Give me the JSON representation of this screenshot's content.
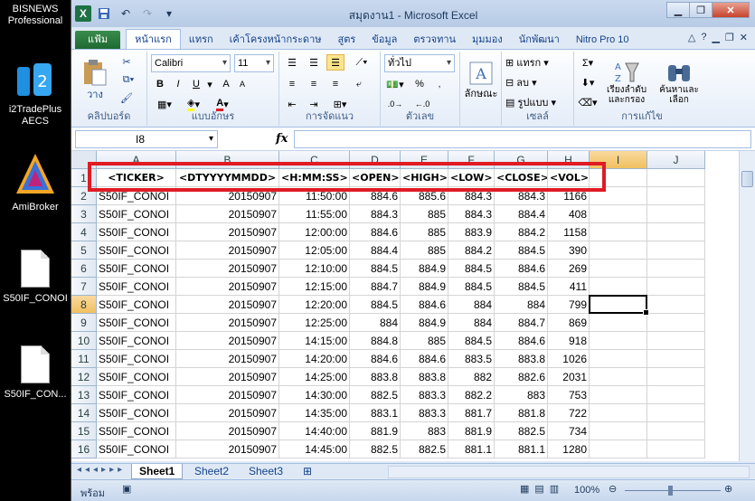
{
  "desktop": {
    "icons": [
      {
        "label": "BISNEWS Professional",
        "icon": "bisnews-icon"
      },
      {
        "label": "i2TradePlus AECS",
        "icon": "i2tradeplus-icon"
      },
      {
        "label": "AmiBroker",
        "icon": "amibroker-icon"
      },
      {
        "label": "S50IF_CONOI",
        "icon": "document-icon"
      },
      {
        "label": "S50IF_CON...",
        "icon": "document-icon"
      }
    ]
  },
  "window": {
    "title": "สมุดงาน1 - Microsoft Excel",
    "accent": "#1e7145"
  },
  "ribbon": {
    "tabs": [
      "แฟ้ม",
      "หน้าแรก",
      "แทรก",
      "เค้าโครงหน้ากระดาษ",
      "สูตร",
      "ข้อมูล",
      "ตรวจทาน",
      "มุมมอง",
      "นักพัฒนา",
      "Nitro Pro 10"
    ],
    "active_tab": "หน้าแรก",
    "font_name": "Calibri",
    "font_size": "11",
    "number_format": "ทั่วไป",
    "groups": {
      "clipboard": "คลิปบอร์ด",
      "font": "แบบอักษร",
      "alignment": "การจัดแนว",
      "number": "ตัวเลข",
      "cells": "เซลล์",
      "editing": "การแก้ไข"
    },
    "buttons": {
      "paste": "วาง",
      "styles": "ลักษณะ",
      "insert": "แทรก",
      "delete": "ลบ",
      "format": "รูปแบบ",
      "sort_filter_1": "เรียงลำดับ",
      "sort_filter_2": "และกรอง",
      "find_select_1": "ค้นหาและ",
      "find_select_2": "เลือก",
      "bold": "B",
      "italic": "I",
      "underline": "U"
    }
  },
  "formula_bar": {
    "name_box": "I8",
    "fx": "fx",
    "value": ""
  },
  "grid": {
    "columns": [
      "A",
      "B",
      "C",
      "D",
      "E",
      "F",
      "G",
      "H",
      "I",
      "J"
    ],
    "selected_column": "I",
    "selected_row": 8,
    "header_row": [
      "<TICKER>",
      "<DTYYYYMMDD>",
      "<H:MM:SS>",
      "<OPEN>",
      "<HIGH>",
      "<LOW>",
      "<CLOSE>",
      "<VOL>"
    ],
    "rows": [
      {
        "n": 2,
        "cells": [
          "S50IF_CONOI",
          "20150907",
          "11:50:00",
          "884.6",
          "885.6",
          "884.3",
          "884.3",
          "1166"
        ]
      },
      {
        "n": 3,
        "cells": [
          "S50IF_CONOI",
          "20150907",
          "11:55:00",
          "884.3",
          "885",
          "884.3",
          "884.4",
          "408"
        ]
      },
      {
        "n": 4,
        "cells": [
          "S50IF_CONOI",
          "20150907",
          "12:00:00",
          "884.6",
          "885",
          "883.9",
          "884.2",
          "1158"
        ]
      },
      {
        "n": 5,
        "cells": [
          "S50IF_CONOI",
          "20150907",
          "12:05:00",
          "884.4",
          "885",
          "884.2",
          "884.5",
          "390"
        ]
      },
      {
        "n": 6,
        "cells": [
          "S50IF_CONOI",
          "20150907",
          "12:10:00",
          "884.5",
          "884.9",
          "884.5",
          "884.6",
          "269"
        ]
      },
      {
        "n": 7,
        "cells": [
          "S50IF_CONOI",
          "20150907",
          "12:15:00",
          "884.7",
          "884.9",
          "884.5",
          "884.5",
          "411"
        ]
      },
      {
        "n": 8,
        "cells": [
          "S50IF_CONOI",
          "20150907",
          "12:20:00",
          "884.5",
          "884.6",
          "884",
          "884",
          "799"
        ]
      },
      {
        "n": 9,
        "cells": [
          "S50IF_CONOI",
          "20150907",
          "12:25:00",
          "884",
          "884.9",
          "884",
          "884.7",
          "869"
        ]
      },
      {
        "n": 10,
        "cells": [
          "S50IF_CONOI",
          "20150907",
          "14:15:00",
          "884.8",
          "885",
          "884.5",
          "884.6",
          "918"
        ]
      },
      {
        "n": 11,
        "cells": [
          "S50IF_CONOI",
          "20150907",
          "14:20:00",
          "884.6",
          "884.6",
          "883.5",
          "883.8",
          "1026"
        ]
      },
      {
        "n": 12,
        "cells": [
          "S50IF_CONOI",
          "20150907",
          "14:25:00",
          "883.8",
          "883.8",
          "882",
          "882.6",
          "2031"
        ]
      },
      {
        "n": 13,
        "cells": [
          "S50IF_CONOI",
          "20150907",
          "14:30:00",
          "882.5",
          "883.3",
          "882.2",
          "883",
          "753"
        ]
      },
      {
        "n": 14,
        "cells": [
          "S50IF_CONOI",
          "20150907",
          "14:35:00",
          "883.1",
          "883.3",
          "881.7",
          "881.8",
          "722"
        ]
      },
      {
        "n": 15,
        "cells": [
          "S50IF_CONOI",
          "20150907",
          "14:40:00",
          "881.9",
          "883",
          "881.9",
          "882.5",
          "734"
        ]
      },
      {
        "n": 16,
        "cells": [
          "S50IF_CONOI",
          "20150907",
          "14:45:00",
          "882.5",
          "882.5",
          "881.1",
          "881.1",
          "1280"
        ]
      }
    ],
    "highlight_color": "#e01b24"
  },
  "sheets": {
    "tabs": [
      "Sheet1",
      "Sheet2",
      "Sheet3"
    ],
    "active": "Sheet1"
  },
  "status": {
    "ready": "พร้อม",
    "zoom_percent": "100%"
  }
}
